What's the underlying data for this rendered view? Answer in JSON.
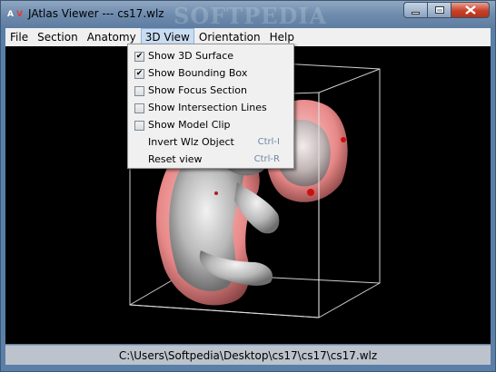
{
  "window": {
    "title": "JAtlas Viewer --- cs17.wlz",
    "watermark": "SOFTPEDIA",
    "app_icon_prefix": "A",
    "app_icon_mark": "V"
  },
  "menubar": {
    "items": [
      {
        "label": "File"
      },
      {
        "label": "Section"
      },
      {
        "label": "Anatomy"
      },
      {
        "label": "3D View"
      },
      {
        "label": "Orientation"
      },
      {
        "label": "Help"
      }
    ],
    "active": "3D View"
  },
  "dropdown": {
    "items": [
      {
        "label": "Show 3D Surface",
        "checkbox": true,
        "checked": true,
        "shortcut": ""
      },
      {
        "label": "Show Bounding Box",
        "checkbox": true,
        "checked": true,
        "shortcut": ""
      },
      {
        "label": "Show Focus Section",
        "checkbox": true,
        "checked": false,
        "shortcut": ""
      },
      {
        "label": "Show Intersection Lines",
        "checkbox": true,
        "checked": false,
        "shortcut": ""
      },
      {
        "label": "Show Model Clip",
        "checkbox": true,
        "checked": false,
        "shortcut": ""
      },
      {
        "label": "Invert Wlz Object",
        "checkbox": false,
        "checked": false,
        "shortcut": "Ctrl-I"
      },
      {
        "label": "Reset view",
        "checkbox": false,
        "checked": false,
        "shortcut": "Ctrl-R"
      }
    ]
  },
  "statusbar": {
    "path": "C:\\Users\\Softpedia\\Desktop\\cs17\\cs17\\cs17.wlz"
  },
  "colors": {
    "surface_grey": "#b8b8b8",
    "surface_pink": "#f2a0a0",
    "bounding_box": "#d8d8d8",
    "highlight_red": "#cc1010"
  }
}
